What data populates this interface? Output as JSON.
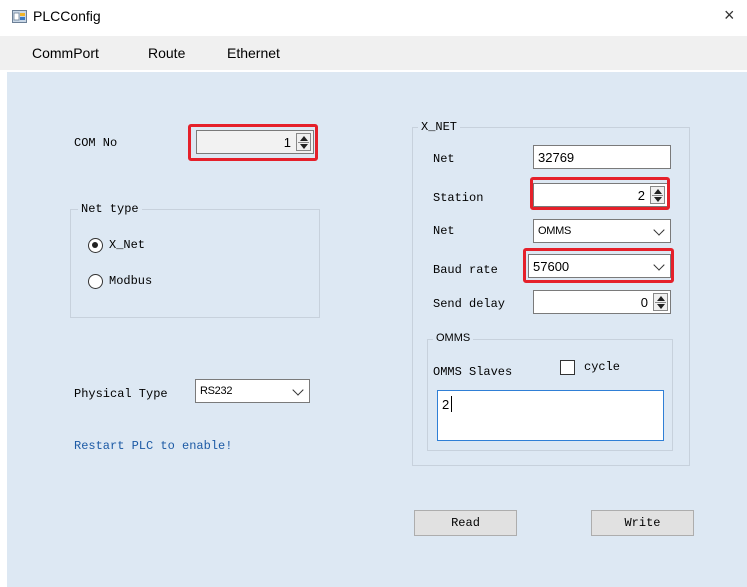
{
  "window": {
    "title": "PLCConfig",
    "close_glyph": "×",
    "icon": "app-icon"
  },
  "menu": [
    "CommPort",
    "Route",
    "Ethernet"
  ],
  "comm": {
    "com_no_label": "COM No",
    "com_no_value": "1",
    "net_type_title": "Net type",
    "net_type_options": [
      "X_Net",
      "Modbus"
    ],
    "net_type_selected": "X_Net",
    "physical_type_label": "Physical Type",
    "physical_type_value": "RS232",
    "notice": "Restart PLC to enable!"
  },
  "xnet": {
    "title": "X_NET",
    "net_label": "Net",
    "net_value": "32769",
    "station_label": "Station",
    "station_value": "2",
    "net2_label": "Net",
    "net2_value": "OMMS",
    "baud_label": "Baud rate",
    "baud_value": "57600",
    "send_delay_label": "Send delay",
    "send_delay_value": "0",
    "omms": {
      "title": "OMMS",
      "slaves_label": "OMMS Slaves",
      "cycle_label": "cycle",
      "cycle_checked": false,
      "slaves_value": "2"
    }
  },
  "buttons": {
    "read": "Read",
    "write": "Write"
  },
  "colors": {
    "client_bg": "#dde8f3",
    "highlight": "#e5202a",
    "notice": "#1c5aa5"
  }
}
